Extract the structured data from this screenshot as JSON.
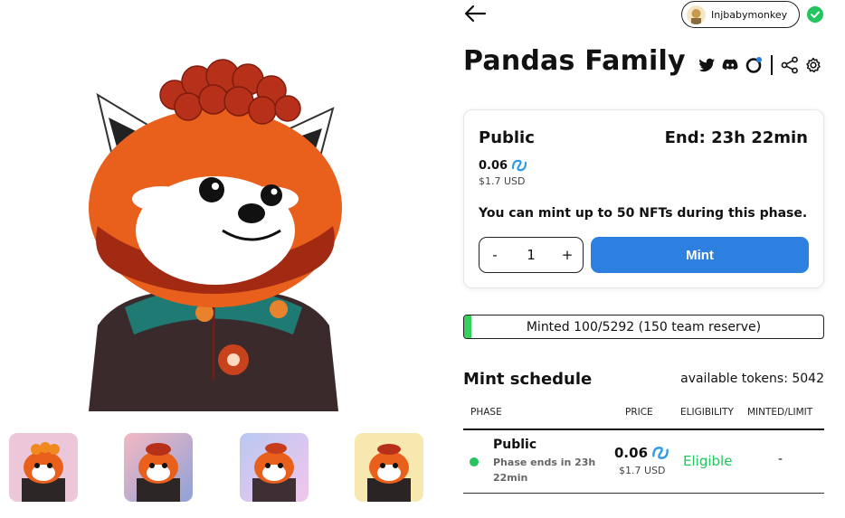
{
  "header": {
    "username": "Injbabymonkey",
    "back_icon": "arrow-left-icon",
    "verified_icon": "check-circle-icon",
    "verified_color": "#22c55e"
  },
  "collection": {
    "title": "Pandas Family",
    "social_icons": [
      "twitter-icon",
      "discord-icon",
      "website-icon",
      "share-icon",
      "gear-icon"
    ]
  },
  "mint_card": {
    "phase": "Public",
    "end_text": "End: 23h 22min",
    "price": "0.06",
    "price_usd": "$1.7 USD",
    "limit_note": "You can mint up to 50 NFTs during this phase.",
    "quantity": "1",
    "minus_label": "-",
    "plus_label": "+",
    "mint_label": "Mint",
    "accent_color": "#2d7fe0",
    "token_icon": "injective-token-icon"
  },
  "progress": {
    "label": "Minted 100/5292 (150 team reserve)",
    "fraction": 0.019,
    "color": "#36d15a"
  },
  "schedule": {
    "title": "Mint schedule",
    "available": "available tokens: 5042",
    "headers": {
      "phase": "PHASE",
      "price": "PRICE",
      "eligibility": "ELIGIBILITY",
      "minted": "MINTED/LIMIT"
    },
    "rows": [
      {
        "phase": "Public",
        "sub": "Phase ends in 23h 22min",
        "price": "0.06",
        "price_usd": "$1.7 USD",
        "eligibility": "Eligible",
        "minted": "-"
      }
    ]
  }
}
